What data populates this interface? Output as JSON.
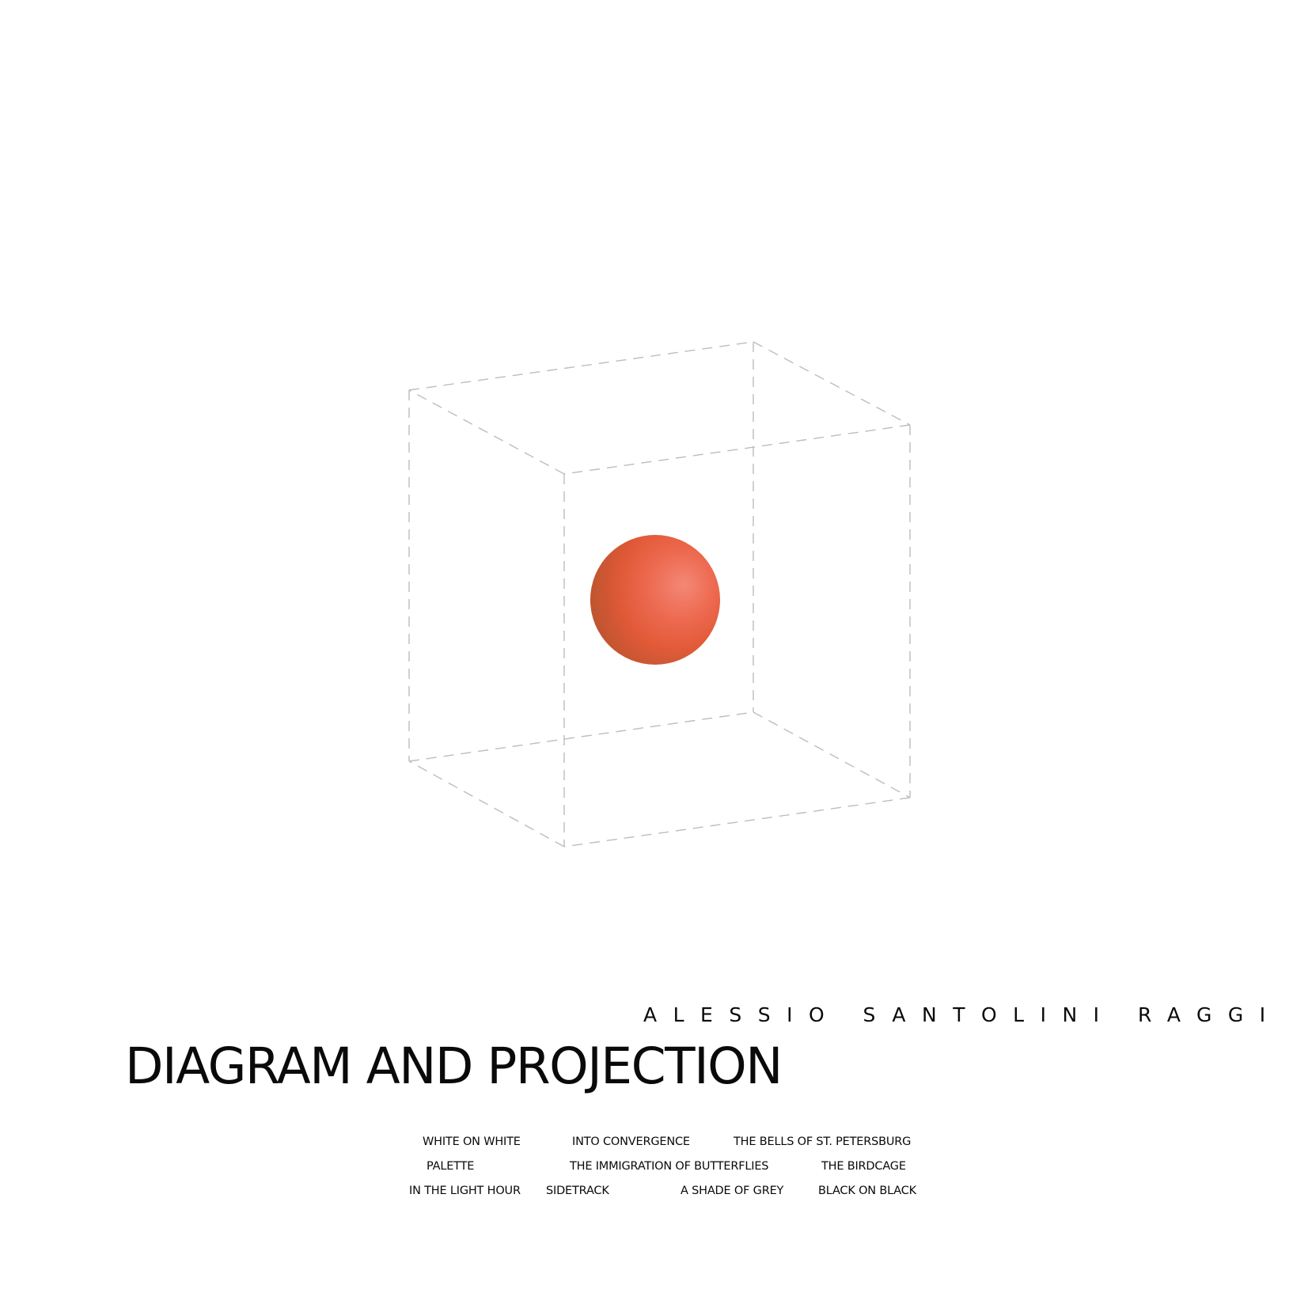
{
  "cover": {
    "artist": "ALESSIO SANTOLINI RAGGI",
    "title": "DIAGRAM AND PROJECTION",
    "tracks": [
      "WHITE ON WHITE",
      "INTO CONVERGENCE",
      "THE BELLS OF ST. PETERSBURG",
      "PALETTE",
      "THE IMMIGRATION OF BUTTERFLIES",
      "THE BIRDCAGE",
      "IN THE LIGHT HOUR",
      "SIDETRACK",
      "A SHADE OF GREY",
      "BLACK ON BLACK"
    ]
  },
  "artwork": {
    "figure": "dashed wireframe cube containing a sphere",
    "cube_line_color": "#bdbdbd",
    "sphere_colors": [
      "#b8542f",
      "#e85c3c",
      "#f07a66"
    ]
  }
}
